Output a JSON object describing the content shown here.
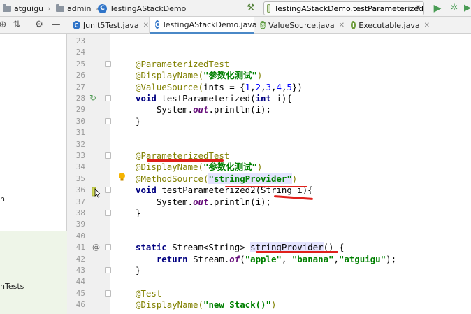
{
  "navbar": {
    "crumbs": [
      "atguigu",
      "admin",
      "TestingAStackDemo"
    ],
    "run_config": "TestingAStackDemo.testParameterized",
    "icons": {
      "build": "hammer-icon",
      "run": "play-icon",
      "debug": "bug-icon"
    }
  },
  "project_panel": {
    "tree_fragments": [
      "n",
      "nTests"
    ],
    "icons": [
      "globe-icon",
      "settings-icon",
      "minus-icon"
    ]
  },
  "tabs": [
    {
      "label": "Junit5Test.java",
      "icon": "C",
      "color": "#2f74c8",
      "active": false
    },
    {
      "label": "TestingAStackDemo.java",
      "icon": "C",
      "color": "#2f74c8",
      "active": true
    },
    {
      "label": "ValueSource.java",
      "icon": "@",
      "color": "#5a9b3c",
      "active": false
    },
    {
      "label": "Executable.java",
      "icon": "I",
      "color": "#6e9b3c",
      "active": false
    }
  ],
  "editor": {
    "line_numbers": [
      "23",
      "24",
      "25",
      "26",
      "27",
      "28",
      "29",
      "30",
      "31",
      "32",
      "33",
      "34",
      "35",
      "36",
      "37",
      "38",
      "39",
      "40",
      "41",
      "42",
      "43",
      "44",
      "45",
      "46"
    ],
    "lines": {
      "l25": "@ParameterizedTest",
      "l26a": "@DisplayName(",
      "l26b": "\"参数化测试\"",
      "l26c": ")",
      "l27a": "@ValueSource(",
      "l27b": "ints = {",
      "l27c": "1",
      "l27d": ",",
      "l27e": "2",
      "l27f": ",",
      "l27g": "3",
      "l27h": ",",
      "l27i": "4",
      "l27j": ",",
      "l27k": "5",
      "l27l": "})",
      "l28a": "void ",
      "l28b": "testParameterized(",
      "l28c": "int ",
      "l28d": "i){",
      "l29a": "    System.",
      "l29b": "out",
      "l29c": ".println(i);",
      "l30": "}",
      "l33": "@ParameterizedTest",
      "l34a": "@DisplayName(",
      "l34b": "\"参数化测试\"",
      "l34c": ")",
      "l35a": "@MethodSource(",
      "l35b": "\"stringProvider\"",
      "l35c": ")",
      "l36a": "void ",
      "l36b": "testParameterized2(String i){",
      "l37a": "    System.",
      "l37b": "out",
      "l37c": ".println(i);",
      "l38": "}",
      "l41a": "static ",
      "l41b": "Stream<String> ",
      "l41c": "stringProvider",
      "l41d": "() {",
      "l42a": "    return ",
      "l42b": "Stream.",
      "l42c": "of",
      "l42d": "(",
      "l42e": "\"apple\"",
      "l42f": ", ",
      "l42g": "\"banana\"",
      "l42h": ",",
      "l42i": "\"atguigu\"",
      "l42j": ");",
      "l43": "}",
      "l45": "@Test",
      "l46a": "@DisplayName(",
      "l46b": "\"new Stack()\"",
      "l46c": ")"
    }
  },
  "colors": {
    "annotation": "#808000",
    "keyword": "#000080",
    "string": "#008000",
    "number": "#0000ff",
    "red_underline": "#e0201b",
    "active_tab_border": "#4a88c7"
  }
}
